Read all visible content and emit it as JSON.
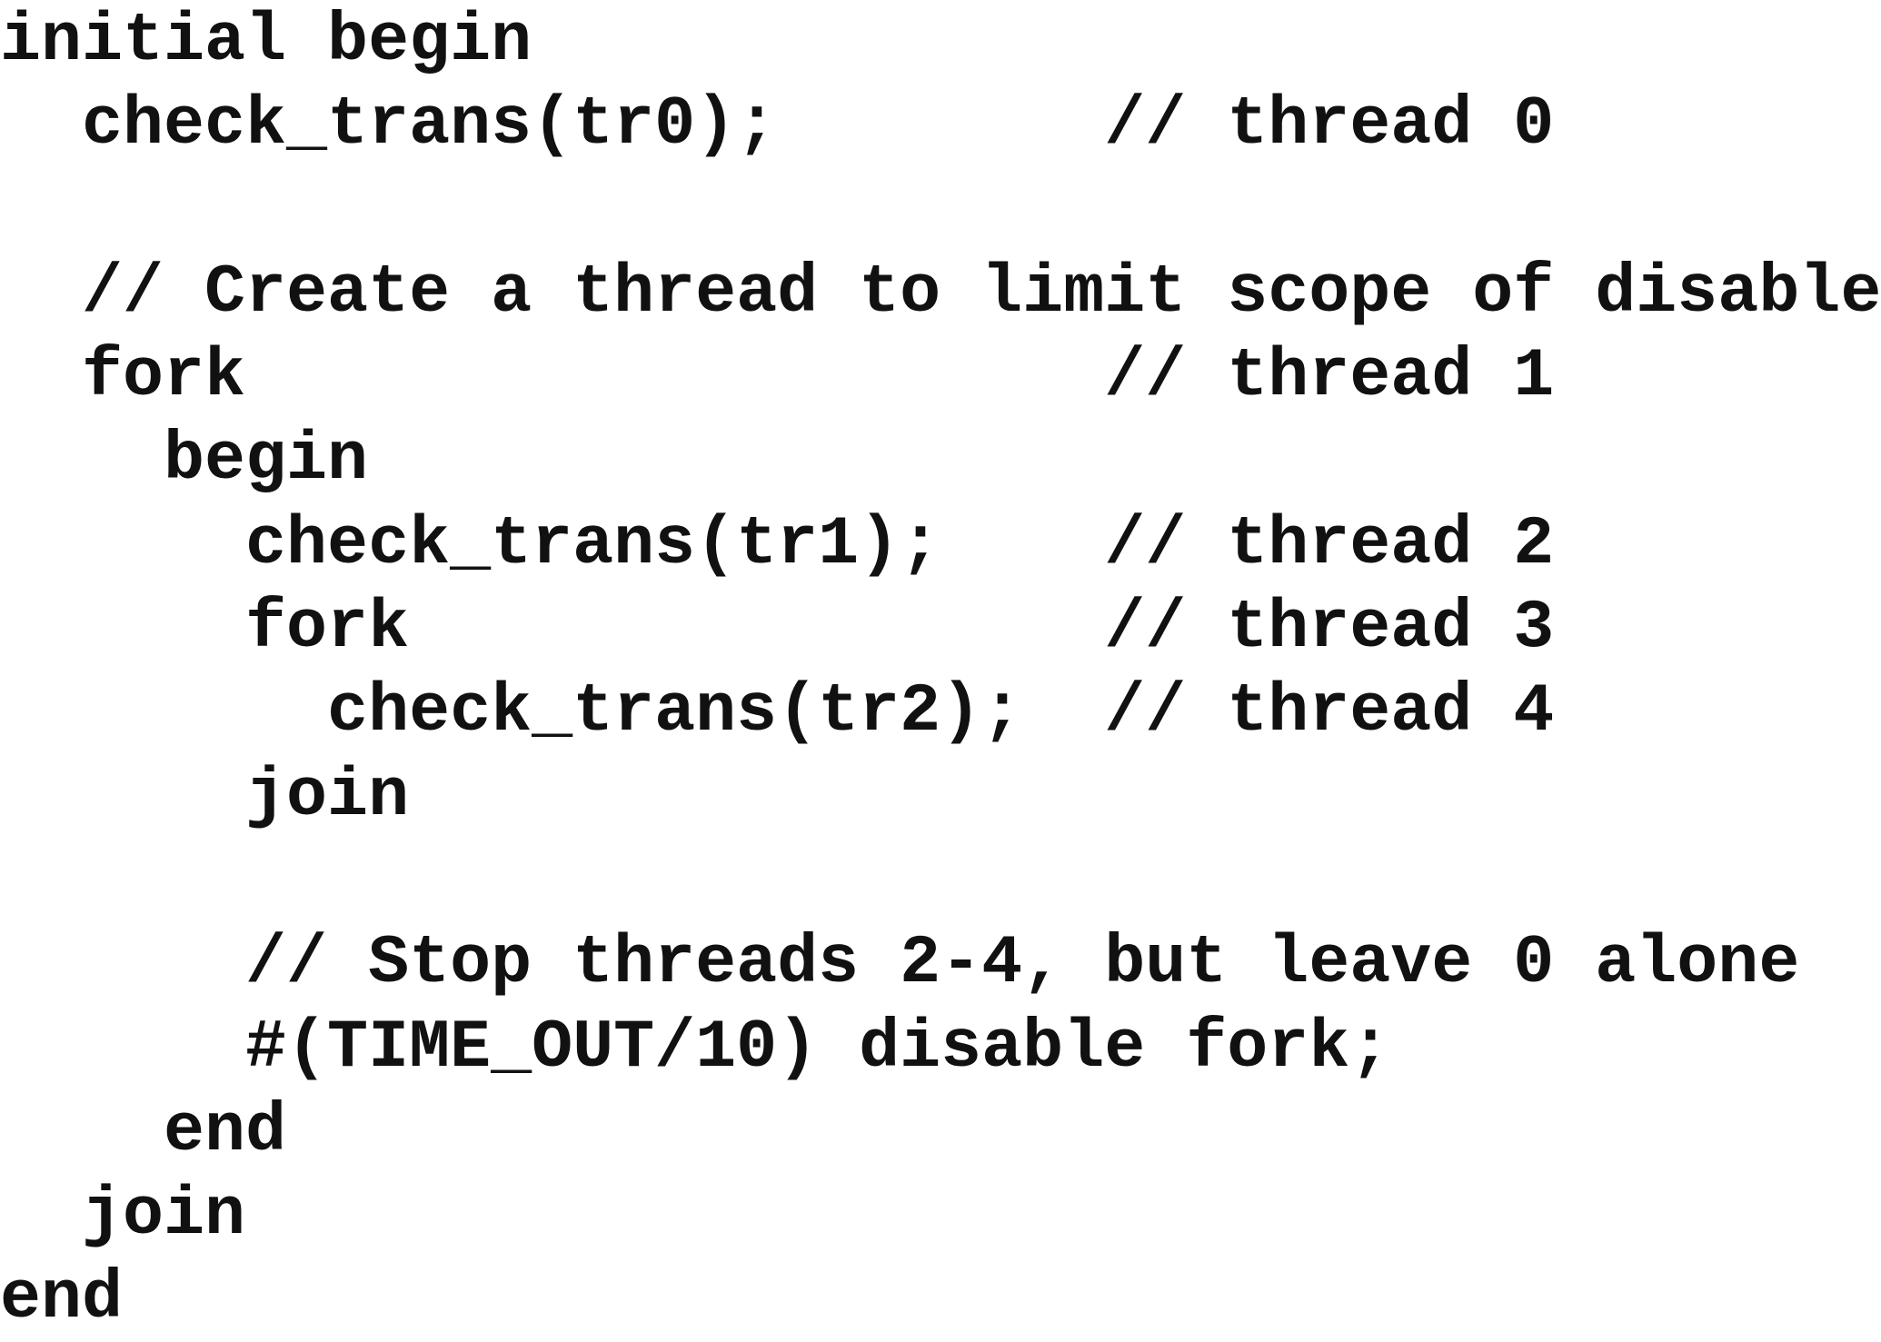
{
  "code": {
    "lines": [
      "initial begin",
      "  check_trans(tr0);        // thread 0",
      "",
      "  // Create a thread to limit scope of disable",
      "  fork                     // thread 1",
      "    begin",
      "      check_trans(tr1);    // thread 2",
      "      fork                 // thread 3",
      "        check_trans(tr2);  // thread 4",
      "      join",
      "",
      "      // Stop threads 2-4, but leave 0 alone",
      "      #(TIME_OUT/10) disable fork;",
      "    end",
      "  join",
      "end"
    ]
  }
}
